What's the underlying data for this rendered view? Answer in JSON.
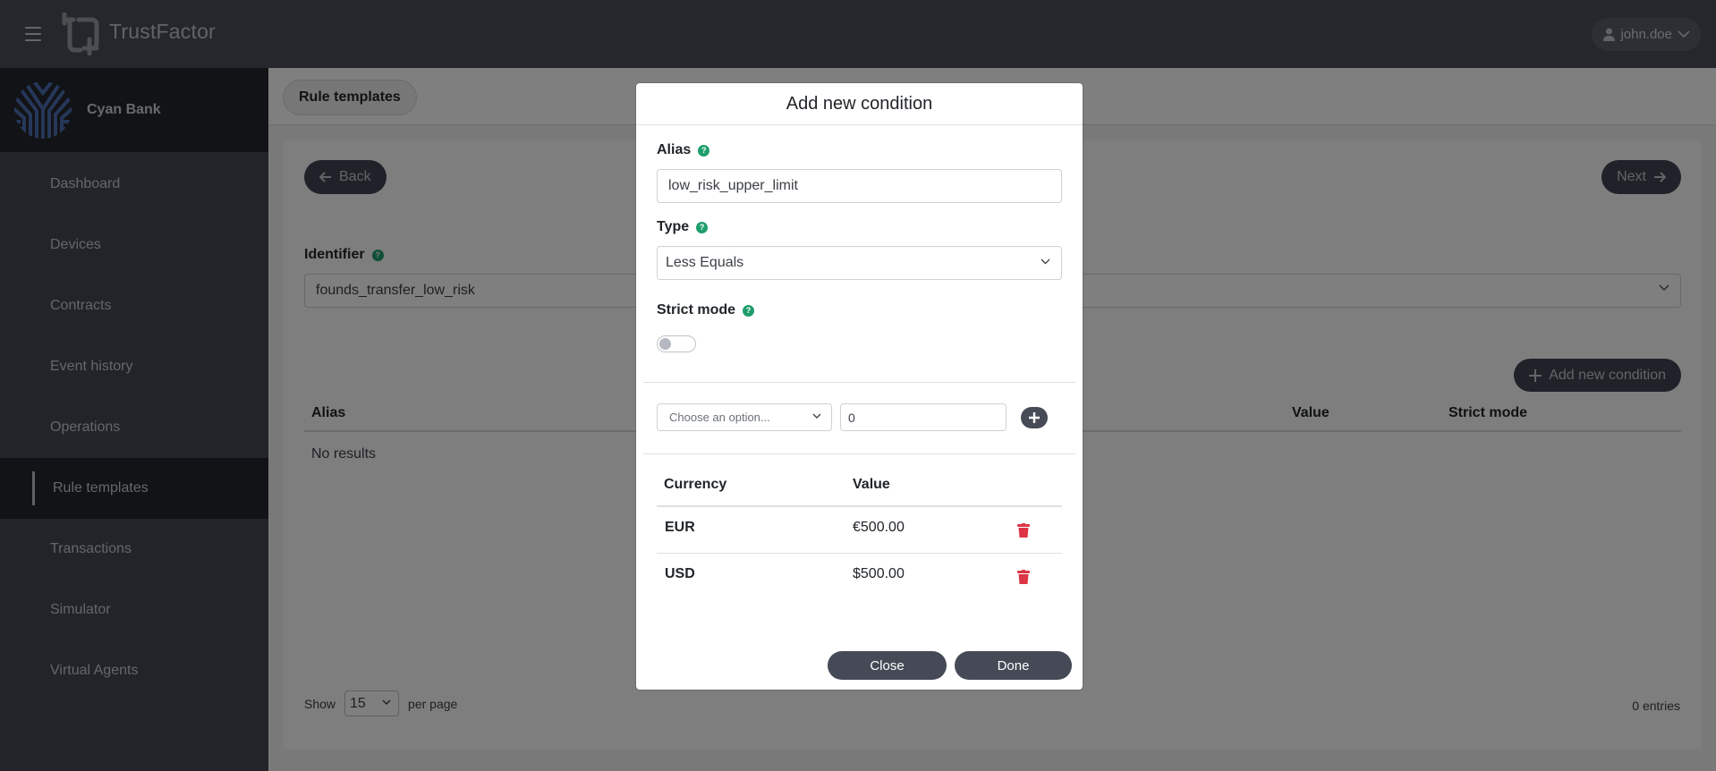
{
  "header": {
    "app_title": "TrustFactor",
    "user_name": "john.doe"
  },
  "sidebar": {
    "bank_name": "Cyan Bank",
    "items": [
      {
        "label": "Dashboard"
      },
      {
        "label": "Devices"
      },
      {
        "label": "Contracts"
      },
      {
        "label": "Event history"
      },
      {
        "label": "Operations"
      },
      {
        "label": "Rule templates",
        "active": true
      },
      {
        "label": "Transactions"
      },
      {
        "label": "Simulator"
      },
      {
        "label": "Virtual Agents"
      }
    ]
  },
  "main": {
    "breadcrumb": "Rule templates",
    "back_label": "Back",
    "next_label": "Next",
    "identifier_label": "Identifier",
    "identifier_value": "founds_transfer_low_risk",
    "add_condition_label": "Add new condition",
    "table": {
      "columns": [
        "Alias",
        "Value",
        "Strict mode"
      ],
      "empty_text": "No results"
    },
    "pager": {
      "show_label": "Show",
      "per_page_value": "15",
      "per_page_label": "per page",
      "entries_text": "0 entries"
    }
  },
  "modal": {
    "title": "Add new condition",
    "alias_label": "Alias",
    "alias_value": "low_risk_upper_limit",
    "type_label": "Type",
    "type_value": "Less Equals",
    "strict_mode_label": "Strict mode",
    "strict_mode_on": false,
    "currency_placeholder": "Choose an option...",
    "amount_value": "0",
    "currency_table": {
      "columns": [
        "Currency",
        "Value"
      ],
      "rows": [
        {
          "currency": "EUR",
          "value": "€500.00"
        },
        {
          "currency": "USD",
          "value": "$500.00"
        }
      ]
    },
    "close_label": "Close",
    "done_label": "Done"
  },
  "colors": {
    "help_icon": "#1e9e6c",
    "delete_icon": "#dc3545",
    "button_dark": "#454a56"
  }
}
